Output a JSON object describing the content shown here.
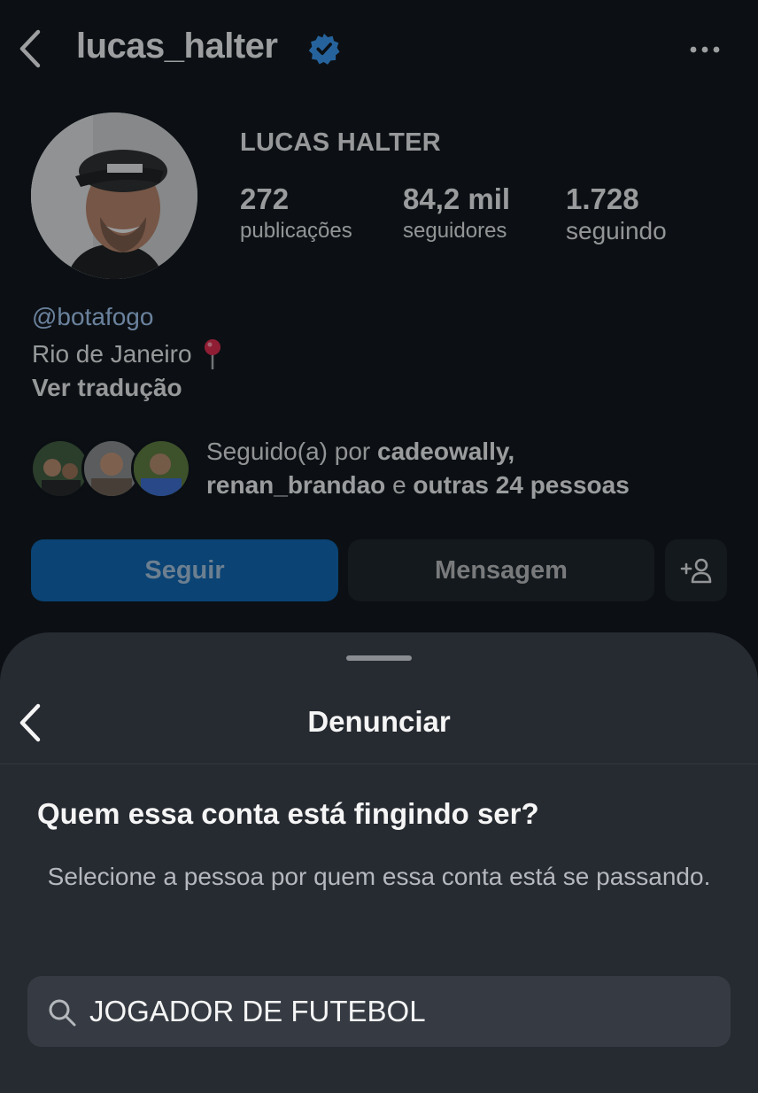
{
  "header": {
    "username": "lucas_halter",
    "verified_icon": "verified-badge-icon",
    "back_icon": "chevron-left-icon",
    "more_icon": "more-horizontal-icon"
  },
  "profile": {
    "full_name": "LUCAS HALTER",
    "stats": [
      {
        "value": "272",
        "label": "publicações"
      },
      {
        "value": "84,2 mil",
        "label": "seguidores"
      },
      {
        "value": "1.728",
        "label": "seguindo"
      }
    ]
  },
  "bio": {
    "link": "@botafogo",
    "city": "Rio de Janeiro",
    "city_icon": "round-pushpin-icon",
    "translate": "Ver tradução"
  },
  "followed_by": {
    "prefix": "Seguido(a) por",
    "user1": "cadeowally,",
    "user2": "renan_brandao",
    "connector": "e",
    "others": "outras 24 pessoas"
  },
  "actions": {
    "follow": "Seguir",
    "message": "Mensagem",
    "add_icon": "add-person-icon"
  },
  "report_sheet": {
    "title": "Denunciar",
    "question": "Quem essa conta está fingindo ser?",
    "description": "Selecione a pessoa por quem essa conta está se passando.",
    "search_value": "JOGADOR DE FUTEBOL",
    "search_icon": "search-icon"
  },
  "colors": {
    "background": "#0c1014",
    "sheet": "#262a31",
    "follow_button": "#0a63b0",
    "verified": "#3897f0",
    "link": "#a5c8f3"
  }
}
